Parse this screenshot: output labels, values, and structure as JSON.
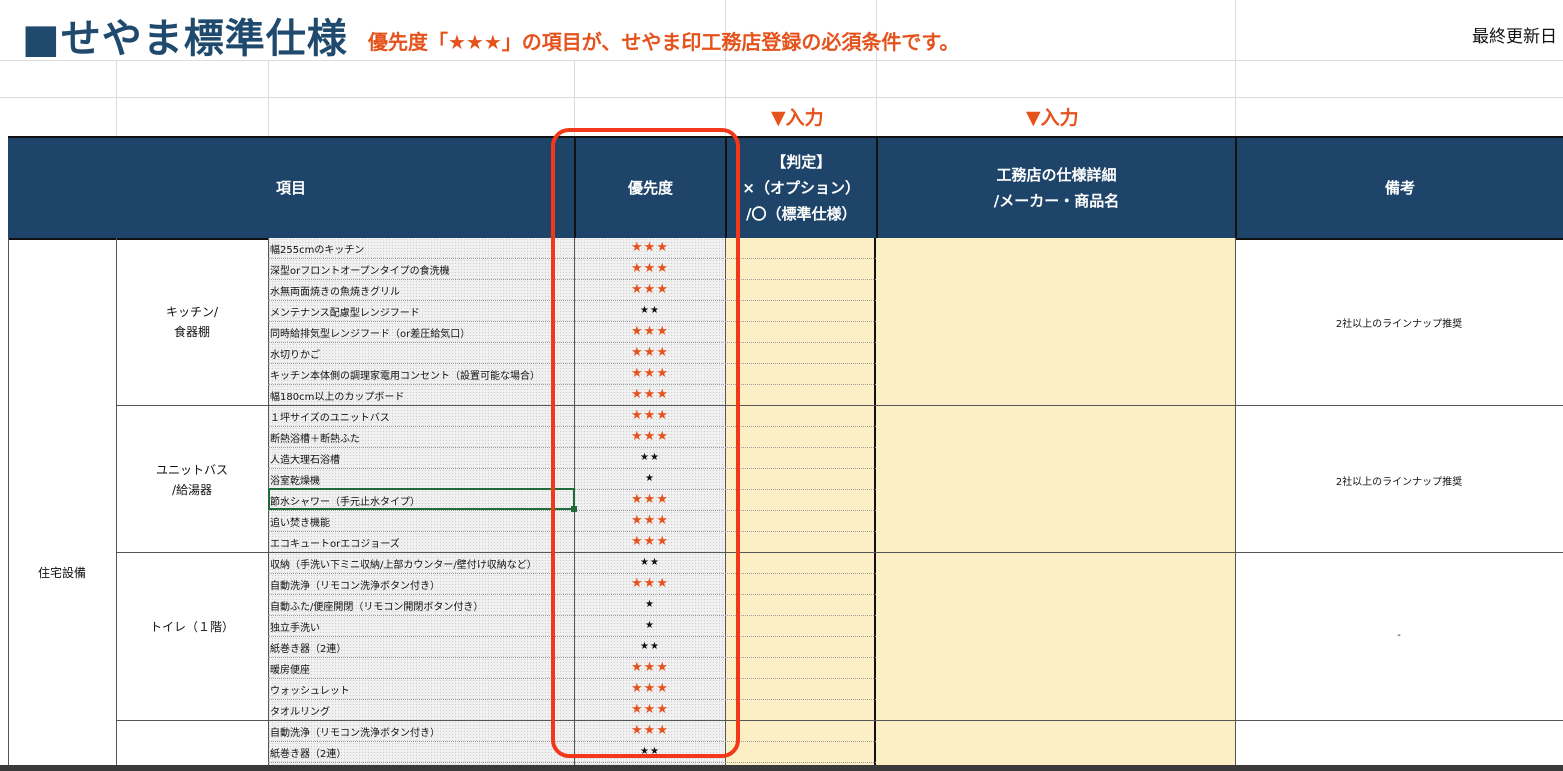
{
  "sheet": {
    "title": "■せやま標準仕様",
    "subtitle": "優先度「★★★」の項目が、せやま印工務店登録の必須条件です。",
    "last_updated_label": "最終更新日",
    "input_marker_1": "▼入力",
    "input_marker_2": "▼入力"
  },
  "header": {
    "item": "項目",
    "priority": "優先度",
    "judgement_line1": "【判定】",
    "judgement_line2": "×（オプション）",
    "judgement_line3": "/〇（標準仕様）",
    "spec_line1": "工務店の仕様詳細",
    "spec_line2": "/メーカー・商品名",
    "notes": "備考"
  },
  "main_category": "住宅設備",
  "groups": [
    {
      "name_line1": "キッチン/",
      "name_line2": "食器棚",
      "note": "2社以上のラインナップ推奨",
      "rows": [
        {
          "label": "幅255cmのキッチン",
          "stars": "★★★",
          "level": 3
        },
        {
          "label": "深型orフロントオープンタイプの食洗機",
          "stars": "★★★",
          "level": 3
        },
        {
          "label": "水無両面焼きの魚焼きグリル",
          "stars": "★★★",
          "level": 3
        },
        {
          "label": "メンテナンス配慮型レンジフード",
          "stars": "★★",
          "level": 2
        },
        {
          "label": "同時給排気型レンジフード（or差圧給気口）",
          "stars": "★★★",
          "level": 3
        },
        {
          "label": "水切りかご",
          "stars": "★★★",
          "level": 3
        },
        {
          "label": "キッチン本体側の調理家電用コンセント（設置可能な場合）",
          "stars": "★★★",
          "level": 3
        },
        {
          "label": "幅180cm以上のカップボード",
          "stars": "★★★",
          "level": 3
        }
      ]
    },
    {
      "name_line1": "ユニットバス",
      "name_line2": "/給湯器",
      "note": "2社以上のラインナップ推奨",
      "rows": [
        {
          "label": "１坪サイズのユニットバス",
          "stars": "★★★",
          "level": 3
        },
        {
          "label": "断熱浴槽＋断熱ふた",
          "stars": "★★★",
          "level": 3
        },
        {
          "label": "人造大理石浴槽",
          "stars": "★★",
          "level": 2
        },
        {
          "label": "浴室乾燥機",
          "stars": "★",
          "level": 1
        },
        {
          "label": "節水シャワー（手元止水タイプ）",
          "stars": "★★★",
          "level": 3
        },
        {
          "label": "追い焚き機能",
          "stars": "★★★",
          "level": 3
        },
        {
          "label": "エコキュートorエコジョーズ",
          "stars": "★★★",
          "level": 3
        }
      ]
    },
    {
      "name_line1": "トイレ（１階）",
      "name_line2": "",
      "note": "-",
      "rows": [
        {
          "label": "収納（手洗い下ミニ収納/上部カウンター/壁付け収納など）",
          "stars": "★★",
          "level": 2
        },
        {
          "label": "自動洗浄（リモコン洗浄ボタン付き）",
          "stars": "★★★",
          "level": 3
        },
        {
          "label": "自動ふた/便座開閉（リモコン開閉ボタン付き）",
          "stars": "★",
          "level": 1
        },
        {
          "label": "独立手洗い",
          "stars": "★",
          "level": 1
        },
        {
          "label": "紙巻き器（2連）",
          "stars": "★★",
          "level": 2
        },
        {
          "label": "暖房便座",
          "stars": "★★★",
          "level": 3
        },
        {
          "label": "ウォッシュレット",
          "stars": "★★★",
          "level": 3
        },
        {
          "label": "タオルリング",
          "stars": "★★★",
          "level": 3
        }
      ]
    },
    {
      "name_line1": "",
      "name_line2": "",
      "note": "",
      "rows": [
        {
          "label": "自動洗浄（リモコン洗浄ボタン付き）",
          "stars": "★★★",
          "level": 3
        },
        {
          "label": "紙巻き器（2連）",
          "stars": "★★",
          "level": 2
        }
      ]
    }
  ],
  "colors": {
    "header_bg": "#1e4569",
    "title": "#1f4a6e",
    "accent_orange": "#e5521c",
    "input_yellow": "#fdefc5",
    "highlight_red": "#f23818",
    "selection_green": "#1f6b3a"
  }
}
